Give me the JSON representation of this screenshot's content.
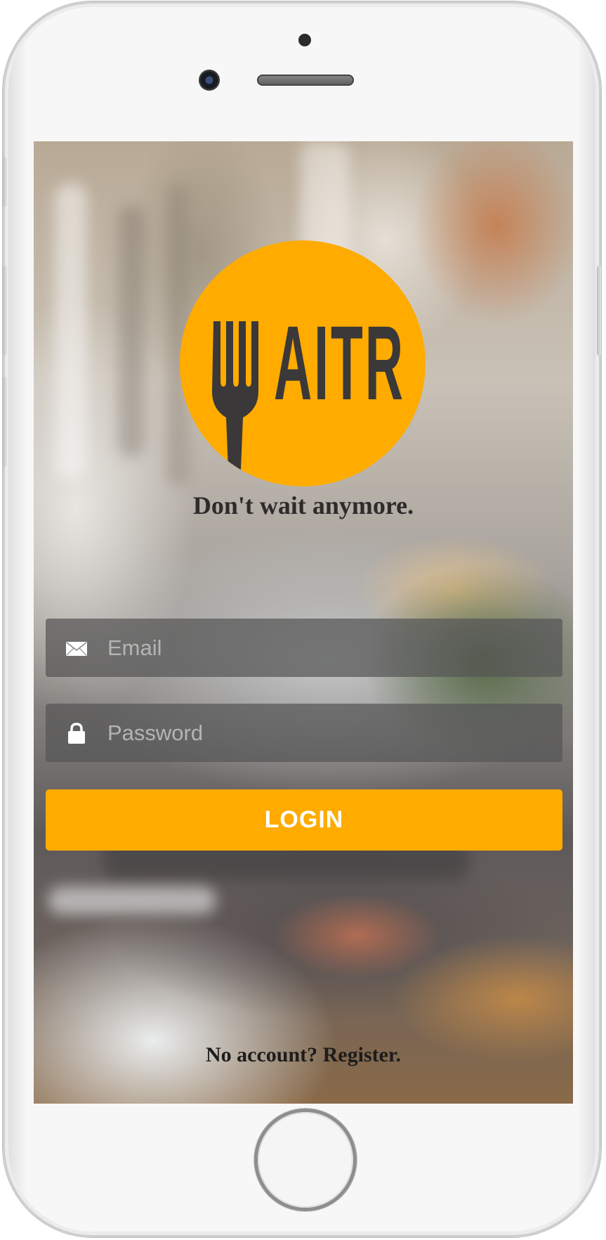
{
  "app": {
    "logo_text": "AITR",
    "tagline": "Don't wait anymore."
  },
  "login_form": {
    "email": {
      "placeholder": "Email",
      "value": ""
    },
    "password": {
      "placeholder": "Password",
      "value": ""
    },
    "login_label": "LOGIN"
  },
  "footer": {
    "register_label": "No account? Register."
  },
  "icons": {
    "email": "envelope-icon",
    "password": "lock-icon",
    "logo": "fork-icon"
  },
  "colors": {
    "accent": "#ffab00",
    "field_background": "rgba(86,86,86,0.72)",
    "logo_text": "#3a3838"
  }
}
